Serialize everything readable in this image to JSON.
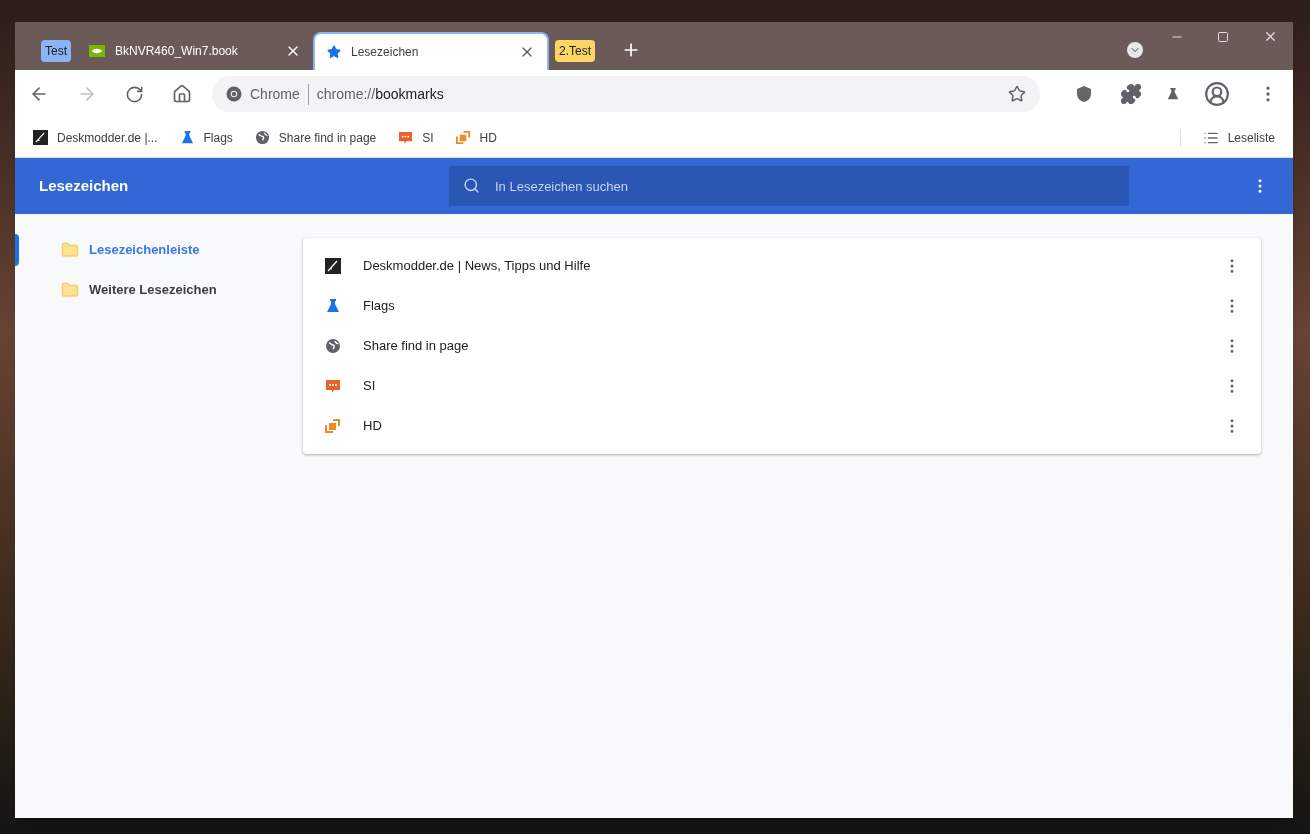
{
  "tabstrip": [
    {
      "kind": "group",
      "label": "Test",
      "color": "#8ab4f8"
    },
    {
      "kind": "tab",
      "title": "BkNVR460_Win7.book",
      "selected": false
    },
    {
      "kind": "tab",
      "title": "Lesezeichen",
      "selected": true
    },
    {
      "kind": "group",
      "label": "2.Test",
      "color": "#fdd663"
    }
  ],
  "omnibox": {
    "origin": "Chrome",
    "url_prefix": "chrome://",
    "url_host": "bookmarks"
  },
  "bookmarks_bar": [
    {
      "title": "Deskmodder.de |...",
      "kind": "deskmodder"
    },
    {
      "title": "Flags",
      "kind": "flask"
    },
    {
      "title": "Share find in page",
      "kind": "globe"
    },
    {
      "title": "SI",
      "kind": "chat"
    },
    {
      "title": "HD",
      "kind": "squares"
    }
  ],
  "reading_list": "Leseliste",
  "header": {
    "title": "Lesezeichen",
    "search_placeholder": "In Lesezeichen suchen"
  },
  "sidebar": {
    "items": [
      {
        "label": "Lesezeichenleiste",
        "selected": true
      },
      {
        "label": "Weitere Lesezeichen",
        "selected": false
      }
    ]
  },
  "list": [
    {
      "title": "Deskmodder.de | News, Tipps und Hilfe",
      "kind": "deskmodder"
    },
    {
      "title": "Flags",
      "kind": "flask"
    },
    {
      "title": "Share find in page",
      "kind": "globe"
    },
    {
      "title": "SI",
      "kind": "chat"
    },
    {
      "title": "HD",
      "kind": "squares"
    }
  ]
}
